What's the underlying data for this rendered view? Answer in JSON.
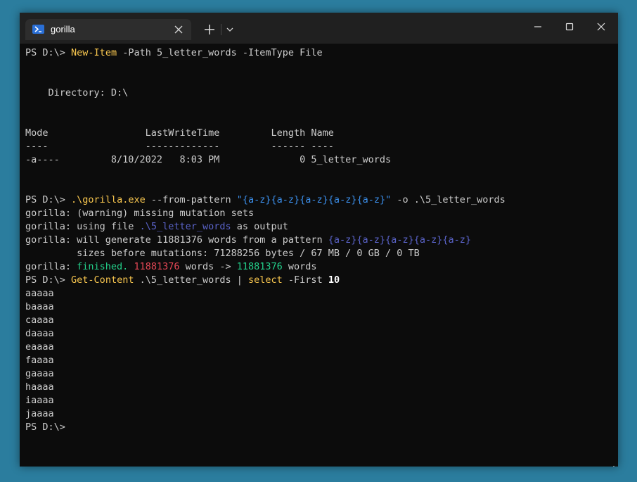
{
  "window": {
    "tab_title": "gorilla",
    "colors": {
      "background": "#2b7d9e",
      "titlebar": "#202020",
      "active_tab": "#2d2d2d",
      "terminal_bg": "#0c0c0c",
      "text": "#cccccc",
      "command": "#f9c74f",
      "string": "#3b8eea",
      "path": "#5a63c9",
      "success": "#23d18b",
      "error": "#e74856"
    },
    "icons": [
      "powershell-icon",
      "close-icon",
      "plus-icon",
      "chevron-down-icon",
      "minimize-icon",
      "maximize-icon",
      "close-window-icon"
    ]
  },
  "terminal": {
    "prompt": "PS D:\\>",
    "cmd1": {
      "name": "New-Item",
      "args": " -Path 5_letter_words -ItemType File"
    },
    "directory_line": "    Directory: D:\\",
    "table_header": "Mode                 LastWriteTime         Length Name",
    "table_rule": "----                 -------------         ------ ----",
    "table_row": "-a----         8/10/2022   8:03 PM              0 5_letter_words",
    "cmd2": {
      "exe": ".\\gorilla.exe",
      "flag": " --from-pattern ",
      "pattern": "\"{a-z}{a-z}{a-z}{a-z}{a-z}\"",
      "rest": " -o .\\5_letter_words"
    },
    "out_warning": "gorilla: (warning) missing mutation sets",
    "out_using_pre": "gorilla: using file ",
    "out_using_path": ".\\5_letter_words",
    "out_using_post": " as output",
    "out_generate_pre": "gorilla: will generate 11881376 words from a pattern ",
    "out_generate_pattern": "{a-z}{a-z}{a-z}{a-z}{a-z}",
    "out_sizes": "         sizes before mutations: 71288256 bytes / 67 MB / 0 GB / 0 TB",
    "out_finished_pre": "gorilla: ",
    "out_finished_word": "finished.",
    "out_count_red": "11881376",
    "out_words_arrow": " words -> ",
    "out_count_green": "11881376",
    "out_words_end": " words",
    "cmd3": {
      "name": "Get-Content",
      "mid": " .\\5_letter_words | ",
      "select": "select",
      "flag": " -First ",
      "num": "10"
    },
    "results": [
      "aaaaa",
      "baaaa",
      "caaaa",
      "daaaa",
      "eaaaa",
      "faaaa",
      "gaaaa",
      "haaaa",
      "iaaaa",
      "jaaaa"
    ]
  }
}
